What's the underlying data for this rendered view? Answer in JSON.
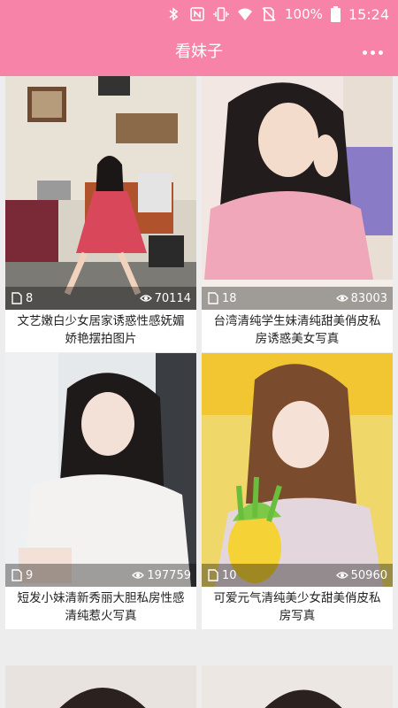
{
  "status_bar": {
    "battery": "100%",
    "time": "15:24",
    "icons": [
      "bluetooth-icon",
      "nfc-icon",
      "vibrate-icon",
      "wifi-icon",
      "no-sim-icon",
      "battery-icon"
    ]
  },
  "app_bar": {
    "title": "看妹子",
    "menu_icon": "more-horizontal-icon"
  },
  "colors": {
    "accent": "#f783a9",
    "overlay": "rgba(0,0,0,0.35)"
  },
  "gallery": [
    {
      "count": "8",
      "views": "70114",
      "caption": "文艺嫩白少女居家诱惑性感妩媚娇艳摆拍图片"
    },
    {
      "count": "18",
      "views": "83003",
      "caption": "台湾清纯学生妹清纯甜美俏皮私房诱惑美女写真"
    },
    {
      "count": "9",
      "views": "197759",
      "caption": "短发小妹清新秀丽大胆私房性感清纯惹火写真"
    },
    {
      "count": "10",
      "views": "50960",
      "caption": "可爱元气清纯美少女甜美俏皮私房写真"
    }
  ]
}
